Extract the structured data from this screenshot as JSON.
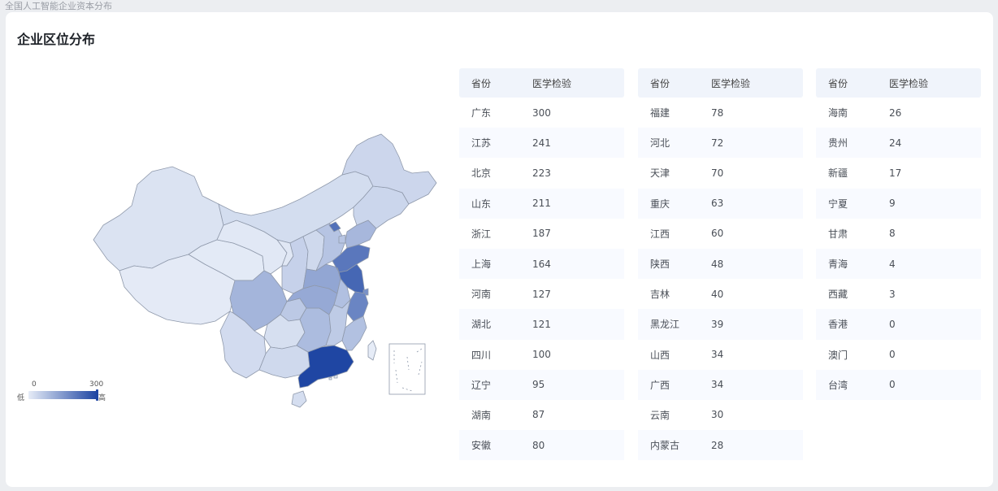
{
  "window": {
    "title": "全国人工智能企业资本分布"
  },
  "card": {
    "title": "企业区位分布"
  },
  "legend": {
    "min": "0",
    "max": "300",
    "low_label": "低",
    "high_label": "高"
  },
  "colors": {
    "low": "#e6ecf7",
    "high": "#1f46a3",
    "border": "#8f99ab"
  },
  "table_headers": {
    "province": "省份",
    "value": "医学检验"
  },
  "rows": [
    {
      "province": "广东",
      "value": "300"
    },
    {
      "province": "江苏",
      "value": "241"
    },
    {
      "province": "北京",
      "value": "223"
    },
    {
      "province": "山东",
      "value": "211"
    },
    {
      "province": "浙江",
      "value": "187"
    },
    {
      "province": "上海",
      "value": "164"
    },
    {
      "province": "河南",
      "value": "127"
    },
    {
      "province": "湖北",
      "value": "121"
    },
    {
      "province": "四川",
      "value": "100"
    },
    {
      "province": "辽宁",
      "value": "95"
    },
    {
      "province": "湖南",
      "value": "87"
    },
    {
      "province": "安徽",
      "value": "80"
    },
    {
      "province": "福建",
      "value": "78"
    },
    {
      "province": "河北",
      "value": "72"
    },
    {
      "province": "天津",
      "value": "70"
    },
    {
      "province": "重庆",
      "value": "63"
    },
    {
      "province": "江西",
      "value": "60"
    },
    {
      "province": "陕西",
      "value": "48"
    },
    {
      "province": "吉林",
      "value": "40"
    },
    {
      "province": "黑龙江",
      "value": "39"
    },
    {
      "province": "山西",
      "value": "34"
    },
    {
      "province": "广西",
      "value": "34"
    },
    {
      "province": "云南",
      "value": "30"
    },
    {
      "province": "内蒙古",
      "value": "28"
    },
    {
      "province": "海南",
      "value": "26"
    },
    {
      "province": "贵州",
      "value": "24"
    },
    {
      "province": "新疆",
      "value": "17"
    },
    {
      "province": "宁夏",
      "value": "9"
    },
    {
      "province": "甘肃",
      "value": "8"
    },
    {
      "province": "青海",
      "value": "4"
    },
    {
      "province": "西藏",
      "value": "3"
    },
    {
      "province": "香港",
      "value": "0"
    },
    {
      "province": "澳门",
      "value": "0"
    },
    {
      "province": "台湾",
      "value": "0"
    }
  ]
}
